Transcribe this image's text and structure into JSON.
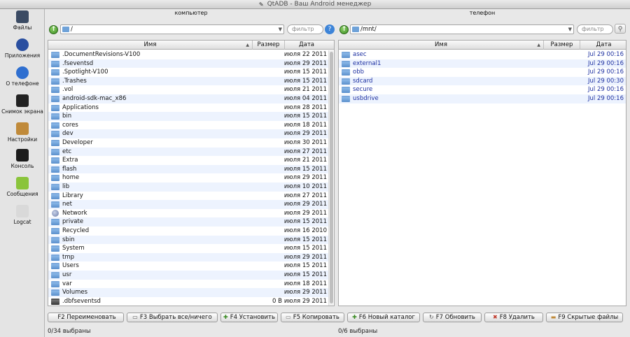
{
  "window": {
    "title": "QtADB - Ваш Android менеджер"
  },
  "sidebar": {
    "items": [
      {
        "label": "Файлы",
        "icon": "files-icon",
        "color": "#3a4a63"
      },
      {
        "label": "Приложения",
        "icon": "gear-icon",
        "color": "#2a4fa0"
      },
      {
        "label": "О телефоне",
        "icon": "info-icon",
        "color": "#2f6fd0"
      },
      {
        "label": "Снимок экрана",
        "icon": "phone-icon",
        "color": "#222222"
      },
      {
        "label": "Настройки",
        "icon": "tools-icon",
        "color": "#c08a3a"
      },
      {
        "label": "Консоль",
        "icon": "terminal-icon",
        "color": "#1b1b1b"
      },
      {
        "label": "Сообщения",
        "icon": "messages-icon",
        "color": "#8ac43b"
      },
      {
        "label": "Logcat",
        "icon": "log-icon",
        "color": "#d9d9d9"
      }
    ]
  },
  "left": {
    "title": "компьютер",
    "path": "/",
    "filter_placeholder": "фильтр",
    "columns": {
      "name": "Имя",
      "size": "Размер",
      "date": "Дата"
    },
    "rows": [
      {
        "name": ".DocumentRevisions-V100",
        "size": "",
        "date": "июля 22 2011",
        "icon": "folder"
      },
      {
        "name": ".fseventsd",
        "size": "",
        "date": "июля 29 2011",
        "icon": "folder"
      },
      {
        "name": ".Spotlight-V100",
        "size": "",
        "date": "июля 15 2011",
        "icon": "folder"
      },
      {
        "name": ".Trashes",
        "size": "",
        "date": "июля 15 2011",
        "icon": "folder"
      },
      {
        "name": ".vol",
        "size": "",
        "date": "июля 21 2011",
        "icon": "folder"
      },
      {
        "name": "android-sdk-mac_x86",
        "size": "",
        "date": "июля 04 2011",
        "icon": "folder"
      },
      {
        "name": "Applications",
        "size": "",
        "date": "июля 28 2011",
        "icon": "folder"
      },
      {
        "name": "bin",
        "size": "",
        "date": "июля 15 2011",
        "icon": "folder"
      },
      {
        "name": "cores",
        "size": "",
        "date": "июля 18 2011",
        "icon": "folder"
      },
      {
        "name": "dev",
        "size": "",
        "date": "июля 29 2011",
        "icon": "folder"
      },
      {
        "name": "Developer",
        "size": "",
        "date": "июля 30 2011",
        "icon": "folder"
      },
      {
        "name": "etc",
        "size": "",
        "date": "июля 27 2011",
        "icon": "folder"
      },
      {
        "name": "Extra",
        "size": "",
        "date": "июля 21 2011",
        "icon": "folder"
      },
      {
        "name": "flash",
        "size": "",
        "date": "июля 15 2011",
        "icon": "folder"
      },
      {
        "name": "home",
        "size": "",
        "date": "июля 29 2011",
        "icon": "folder"
      },
      {
        "name": "lib",
        "size": "",
        "date": "июля 10 2011",
        "icon": "folder"
      },
      {
        "name": "Library",
        "size": "",
        "date": "июля 27 2011",
        "icon": "folder"
      },
      {
        "name": "net",
        "size": "",
        "date": "июля 29 2011",
        "icon": "folder"
      },
      {
        "name": "Network",
        "size": "",
        "date": "июля 29 2011",
        "icon": "network"
      },
      {
        "name": "private",
        "size": "",
        "date": "июля 15 2011",
        "icon": "folder"
      },
      {
        "name": "Recycled",
        "size": "",
        "date": "июля 16 2010",
        "icon": "folder"
      },
      {
        "name": "sbin",
        "size": "",
        "date": "июля 15 2011",
        "icon": "folder"
      },
      {
        "name": "System",
        "size": "",
        "date": "июля 15 2011",
        "icon": "folder"
      },
      {
        "name": "tmp",
        "size": "",
        "date": "июля 29 2011",
        "icon": "folder"
      },
      {
        "name": "Users",
        "size": "",
        "date": "июля 15 2011",
        "icon": "folder"
      },
      {
        "name": "usr",
        "size": "",
        "date": "июля 15 2011",
        "icon": "folder"
      },
      {
        "name": "var",
        "size": "",
        "date": "июля 18 2011",
        "icon": "folder"
      },
      {
        "name": "Volumes",
        "size": "",
        "date": "июля 29 2011",
        "icon": "folder"
      },
      {
        "name": ".dbfseventsd",
        "size": "0 B",
        "date": "июля 29 2011",
        "icon": "file"
      }
    ],
    "status": "0/34 выбраны"
  },
  "right": {
    "title": "телефон",
    "path": "/mnt/",
    "filter_placeholder": "фильтр",
    "columns": {
      "name": "Имя",
      "size": "Размер",
      "date": "Дата"
    },
    "rows": [
      {
        "name": "asec",
        "size": "",
        "date": "Jul 29 00:16",
        "icon": "folder"
      },
      {
        "name": "external1",
        "size": "",
        "date": "Jul 29 00:16",
        "icon": "folder"
      },
      {
        "name": "obb",
        "size": "",
        "date": "Jul 29 00:16",
        "icon": "folder"
      },
      {
        "name": "sdcard",
        "size": "",
        "date": "Jul 29 00:30",
        "icon": "folder"
      },
      {
        "name": "secure",
        "size": "",
        "date": "Jul 29 00:16",
        "icon": "folder"
      },
      {
        "name": "usbdrive",
        "size": "",
        "date": "Jul 29 00:16",
        "icon": "folder"
      }
    ],
    "status": "0/6 выбраны"
  },
  "function_bar": [
    {
      "label": "F2 Переименовать",
      "icon": "rename-icon",
      "glyph": ""
    },
    {
      "label": "F3 Выбрать все/ничего",
      "icon": "select-all-icon",
      "glyph": "▭"
    },
    {
      "label": "F4 Установить",
      "icon": "install-icon",
      "glyph": "✚"
    },
    {
      "label": "F5 Копировать",
      "icon": "copy-icon",
      "glyph": "▭"
    },
    {
      "label": "F6 Новый каталог",
      "icon": "new-folder-icon",
      "glyph": "✚"
    },
    {
      "label": "F7 Обновить",
      "icon": "refresh-icon",
      "glyph": "↻"
    },
    {
      "label": "F8 Удалить",
      "icon": "delete-icon",
      "glyph": "✖"
    },
    {
      "label": "F9 Скрытые файлы",
      "icon": "hidden-files-icon",
      "glyph": "▬"
    }
  ],
  "colors": {
    "accent_green": "#3a8a22",
    "link_blue": "#1c2fa0",
    "row_alt": "#edf3fe",
    "delete_red": "#c0392b"
  }
}
